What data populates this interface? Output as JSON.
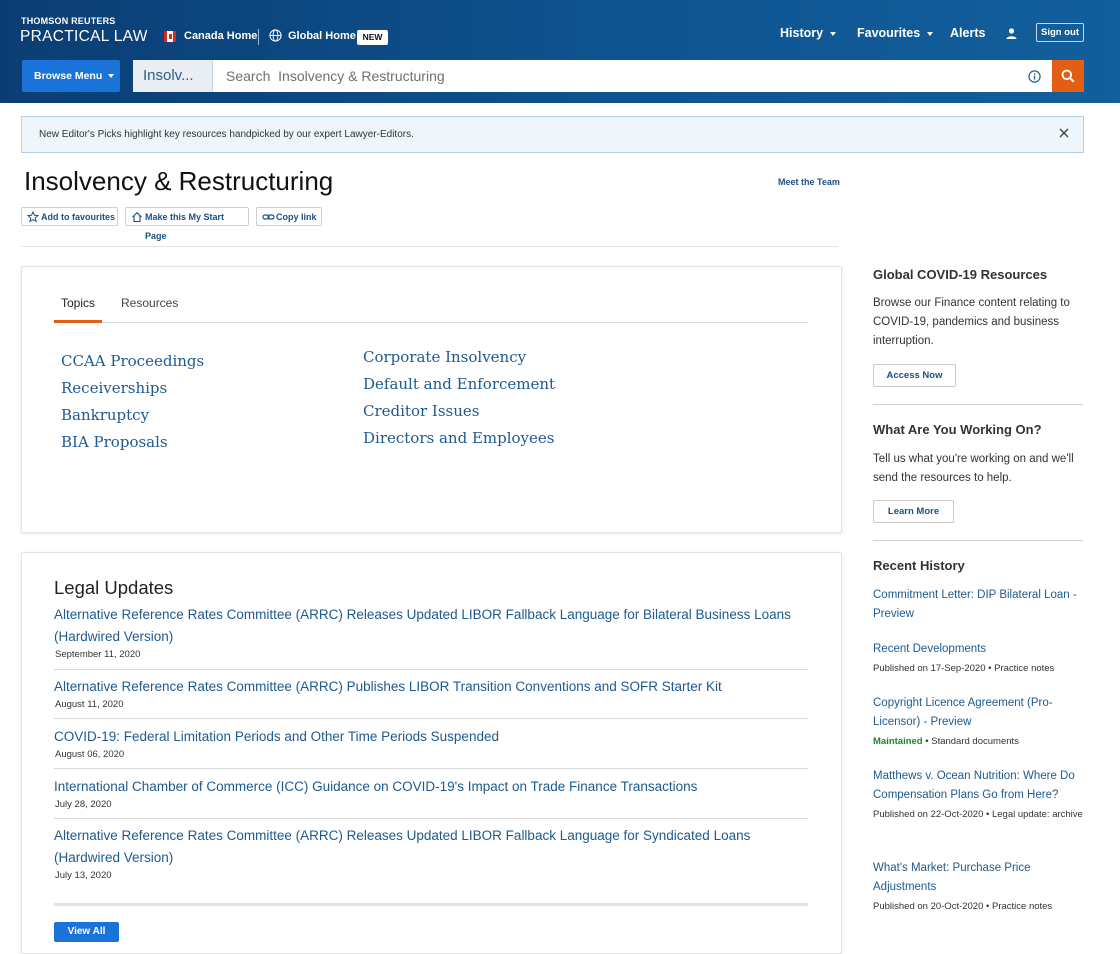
{
  "header": {
    "brand_top": "THOMSON REUTERS",
    "brand_main": "PRACTICAL LAW",
    "canada_home": "Canada Home",
    "global_home": "Global Home",
    "new_badge": "NEW",
    "nav": {
      "history": "History",
      "favourites": "Favourites",
      "alerts": "Alerts"
    },
    "sign_out": "Sign out",
    "browse_menu": "Browse Menu",
    "search_scope": "Insolv...",
    "search_placeholder": "Search  Insolvency & Restructuring"
  },
  "banner": {
    "text": "New Editor's Picks highlight key resources handpicked by our expert Lawyer-Editors."
  },
  "page": {
    "title": "Insolvency & Restructuring",
    "meet_team": "Meet the Team",
    "actions": {
      "add_favourites": "Add to favourites",
      "start_page": "Make this My Start Page",
      "copy_link": "Copy link"
    }
  },
  "tabs": {
    "topics": "Topics",
    "resources": "Resources"
  },
  "topics": {
    "left": [
      "CCAA Proceedings",
      "Receiverships",
      "Bankruptcy",
      "BIA Proposals"
    ],
    "right": [
      "Corporate Insolvency",
      "Default and Enforcement",
      "Creditor Issues",
      "Directors and Employees"
    ]
  },
  "legal_updates": {
    "title": "Legal Updates",
    "items": [
      {
        "title": "Alternative Reference Rates Committee (ARRC) Releases Updated LIBOR Fallback Language for Bilateral Business Loans (Hardwired Version)",
        "date": "September 11, 2020"
      },
      {
        "title": "Alternative Reference Rates Committee (ARRC) Publishes LIBOR Transition Conventions and SOFR Starter Kit",
        "date": "August 11, 2020"
      },
      {
        "title": "COVID-19: Federal Limitation Periods and Other Time Periods Suspended",
        "date": "August 06, 2020"
      },
      {
        "title": "International Chamber of Commerce (ICC) Guidance on COVID-19's Impact on Trade Finance Transactions",
        "date": "July 28, 2020"
      },
      {
        "title": "Alternative Reference Rates Committee (ARRC) Releases Updated LIBOR Fallback Language for Syndicated Loans (Hardwired Version)",
        "date": "July 13, 2020"
      }
    ],
    "view_all": "View All"
  },
  "sidebar": {
    "covid": {
      "title": "Global COVID-19 Resources",
      "text": "Browse our Finance content relating to COVID-19, pandemics and business interruption.",
      "button": "Access Now"
    },
    "working": {
      "title": "What Are You Working On?",
      "text": "Tell us what you're working on and we'll send the resources to help.",
      "button": "Learn More"
    },
    "recent": {
      "title": "Recent History",
      "items": [
        {
          "title": "Commitment Letter: DIP Bilateral Loan - Preview",
          "meta": ""
        },
        {
          "title": "Recent Developments",
          "meta": "Published on 17-Sep-2020 • Practice notes"
        },
        {
          "title": "Copyright Licence Agreement (Pro-Licensor) - Preview",
          "status": "Maintained",
          "meta": " • Standard documents"
        },
        {
          "title": "Matthews v. Ocean Nutrition: Where Do Compensation Plans Go from Here?",
          "meta": "Published on 22-Oct-2020 • Legal update: archive"
        },
        {
          "title": "What's Market: Purchase Price Adjustments",
          "meta": "Published on 20-Oct-2020 • Practice notes"
        }
      ]
    }
  },
  "colors": {
    "header_bg": "#0e5390",
    "accent_orange": "#e35e14",
    "button_blue": "#1a73d9",
    "link_blue": "#1d5a90",
    "maintained_green": "#1b8a24"
  }
}
